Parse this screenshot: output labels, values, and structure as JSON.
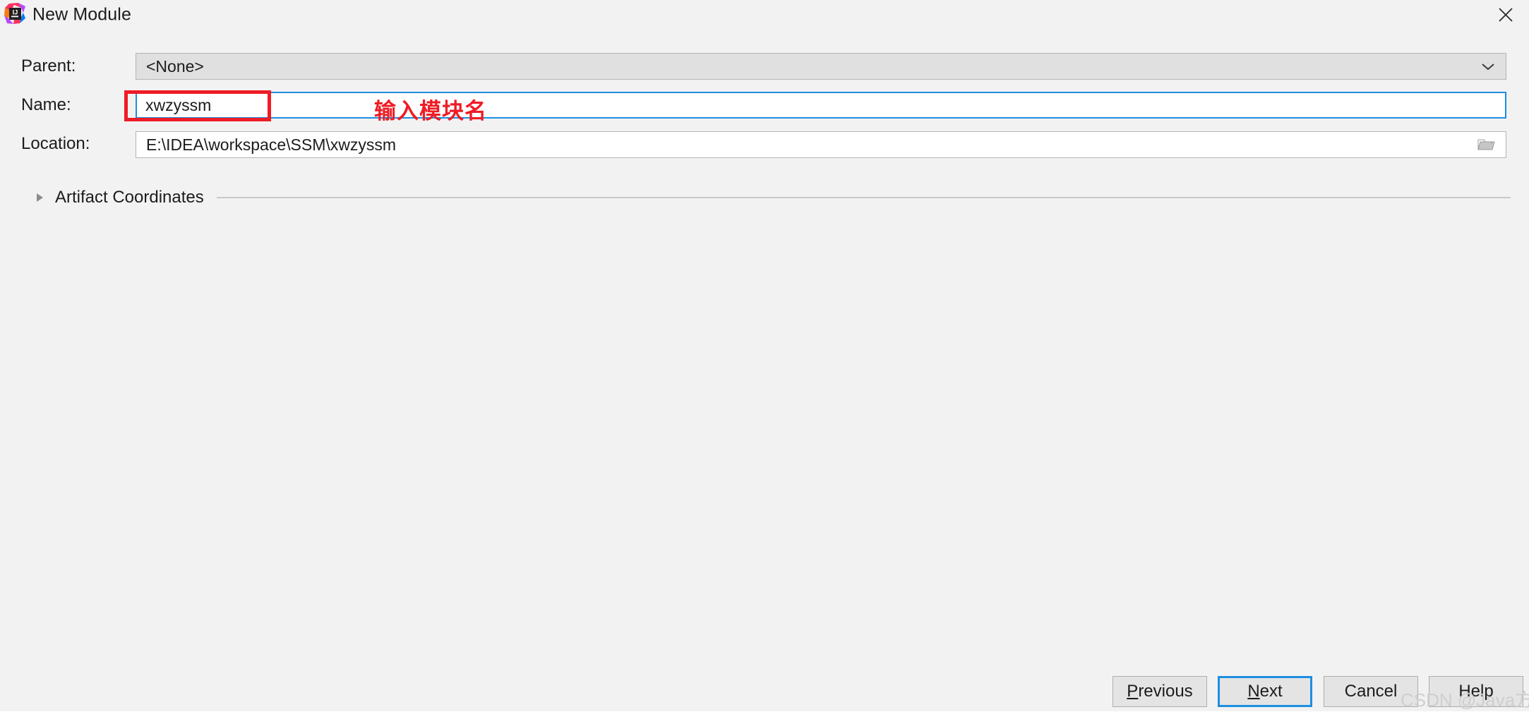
{
  "window": {
    "title": "New Module",
    "app_icon": "intellij-idea-icon",
    "close_icon": "close-icon",
    "background_color": "#f2f2f2"
  },
  "form": {
    "parent": {
      "label": "Parent:",
      "value": "<None>",
      "icon": "chevron-down-icon",
      "enabled": false
    },
    "name": {
      "label": "Name:",
      "value": "xwzyssm",
      "focused": true,
      "focus_color": "#1d8ee0"
    },
    "location": {
      "label": "Location:",
      "value": "E:\\IDEA\\workspace\\SSM\\xwzyssm",
      "icon": "folder-browse-icon"
    }
  },
  "annotation": {
    "text": "输入模块名",
    "color": "#ee1c25",
    "highlights": "name-field"
  },
  "artifact_section": {
    "label": "Artifact Coordinates",
    "icon": "triangle-right-icon",
    "expanded": false
  },
  "buttons": {
    "previous": {
      "label": "Previous",
      "mnemonic": "P",
      "rest": "revious"
    },
    "next": {
      "label": "Next",
      "mnemonic": "N",
      "rest": "ext",
      "focused": true
    },
    "cancel": {
      "label": "Cancel"
    },
    "help": {
      "label": "Help"
    }
  },
  "watermark": {
    "text": "CSDN @Java方文山"
  }
}
